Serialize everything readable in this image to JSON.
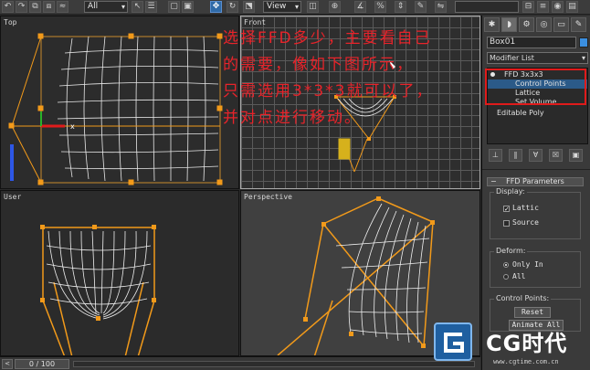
{
  "toolbar": {
    "selection_filter": "All",
    "view_coord": "View",
    "buttons": [
      "undo-icon",
      "redo-icon",
      "link-icon",
      "unlink-icon",
      "bind-icon",
      "select-icon",
      "region-icon",
      "name-icon",
      "move-icon",
      "rotate-icon",
      "scale-icon"
    ]
  },
  "viewports": {
    "top_label": "Top",
    "front_label": "Front",
    "user_label": "User",
    "perspective_label": "Perspective",
    "axis_x": "x"
  },
  "annotation": {
    "line1": "选择FFD多少，主要看自己",
    "line2": "的需要，像如下图所示，",
    "line3": "只需选用3*3*3就可以了，",
    "line4": "并对点进行移动。",
    "color": "#e8232a"
  },
  "panel": {
    "object_name": "Box01",
    "object_color": "#3b8fe0",
    "modifier_list": "Modifier List",
    "stack": {
      "ffd": "FFD 3x3x3",
      "control_points": "Control Points",
      "lattice": "Lattice",
      "set_volume": "Set Volume",
      "editable_poly": "Editable Poly"
    },
    "rollout_title": "FFD Parameters",
    "display": {
      "label": "Display:",
      "lattice": "Lattic",
      "source": "Source"
    },
    "deform": {
      "label": "Deform:",
      "only_in": "Only In",
      "all": "All"
    },
    "control_points": {
      "label": "Control Points:",
      "reset": "Reset",
      "animate_all": "Animate All"
    }
  },
  "timeline": {
    "frame": "0 / 100"
  },
  "watermark": {
    "brand": "CG时代",
    "url": "www.cgtime.com.cn"
  }
}
